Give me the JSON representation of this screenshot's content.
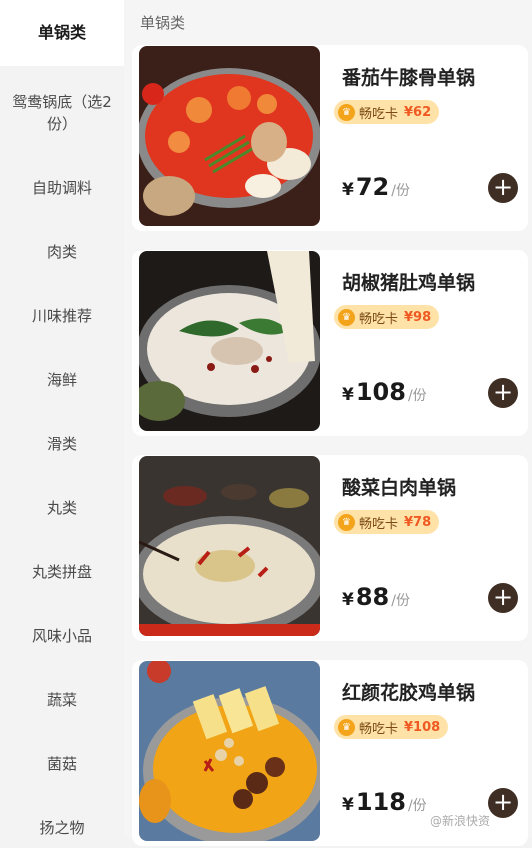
{
  "sidebar": {
    "items": [
      {
        "label": "单锅类",
        "active": true
      },
      {
        "label": "鸳鸯锅底（选2份）",
        "active": false
      },
      {
        "label": "自助调料",
        "active": false
      },
      {
        "label": "肉类",
        "active": false
      },
      {
        "label": "川味推荐",
        "active": false
      },
      {
        "label": "海鲜",
        "active": false
      },
      {
        "label": "滑类",
        "active": false
      },
      {
        "label": "丸类",
        "active": false
      },
      {
        "label": "丸类拼盘",
        "active": false
      },
      {
        "label": "风味小品",
        "active": false
      },
      {
        "label": "蔬菜",
        "active": false
      },
      {
        "label": "菌菇",
        "active": false
      },
      {
        "label": "扬之物",
        "active": false
      }
    ]
  },
  "main": {
    "section_title": "单锅类",
    "products": [
      {
        "name": "番茄牛膝骨单锅",
        "badge_label": "畅吃卡",
        "badge_price": "¥62",
        "currency": "¥",
        "price": "72",
        "unit": "/份"
      },
      {
        "name": "胡椒猪肚鸡单锅",
        "badge_label": "畅吃卡",
        "badge_price": "¥98",
        "currency": "¥",
        "price": "108",
        "unit": "/份"
      },
      {
        "name": "酸菜白肉单锅",
        "badge_label": "畅吃卡",
        "badge_price": "¥78",
        "currency": "¥",
        "price": "88",
        "unit": "/份"
      },
      {
        "name": "红颜花胶鸡单锅",
        "badge_label": "畅吃卡",
        "badge_price": "¥108",
        "currency": "¥",
        "price": "118",
        "unit": "/份"
      }
    ]
  },
  "add_symbol": "+",
  "watermark": "@新浪快资",
  "colors": {
    "accent": "#3f2e23",
    "badge_bg": "#ffe2a8",
    "badge_price": "#ef5a23"
  }
}
